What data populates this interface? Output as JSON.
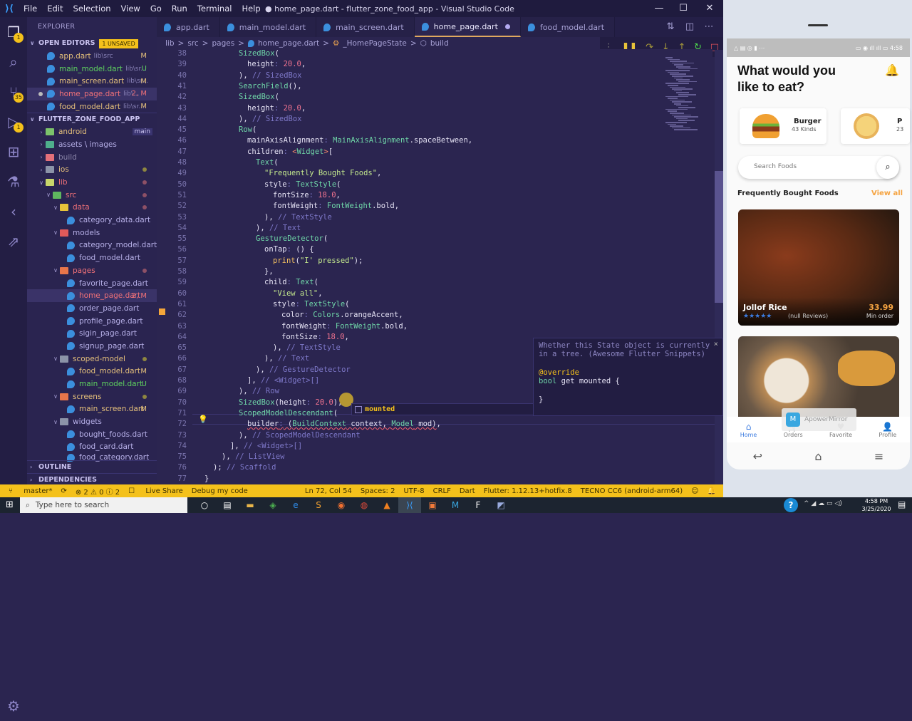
{
  "titlebar": {
    "menus": [
      "File",
      "Edit",
      "Selection",
      "View",
      "Go",
      "Run",
      "Terminal",
      "Help"
    ],
    "title": "● home_page.dart - flutter_zone_food_app - Visual Studio Code",
    "minimize": "—",
    "maximize": "☐",
    "close": "✕"
  },
  "activity": {
    "explorer_badge": "1",
    "scm_badge": "35",
    "debug_badge": "1"
  },
  "sidebar": {
    "header": "EXPLORER",
    "open_editors_label": "OPEN EDITORS",
    "unsaved_badge": "1 UNSAVED",
    "open_editors": [
      {
        "name": "app.dart",
        "path": "lib\\src",
        "status": "M"
      },
      {
        "name": "main_model.dart",
        "path": "lib\\sr...",
        "status": "U"
      },
      {
        "name": "main_screen.dart",
        "path": "lib\\sr...",
        "status": "M"
      },
      {
        "name": "home_page.dart",
        "path": "lib\\...",
        "status": "2, M"
      },
      {
        "name": "food_model.dart",
        "path": "lib\\sr...",
        "status": "M"
      }
    ],
    "project_label": "FLUTTER_ZONE_FOOD_APP",
    "branch_tooltip": "main",
    "tree": [
      {
        "name": "android"
      },
      {
        "name": "assets \\ images"
      },
      {
        "name": "build"
      },
      {
        "name": "ios"
      },
      {
        "name": "lib"
      },
      {
        "name": "src"
      },
      {
        "name": "data"
      },
      {
        "name": "category_data.dart"
      },
      {
        "name": "models"
      },
      {
        "name": "category_model.dart"
      },
      {
        "name": "food_model.dart"
      },
      {
        "name": "pages"
      },
      {
        "name": "favorite_page.dart"
      },
      {
        "name": "home_page.dart",
        "status": "2, M"
      },
      {
        "name": "order_page.dart"
      },
      {
        "name": "profile_page.dart"
      },
      {
        "name": "sigin_page.dart"
      },
      {
        "name": "signup_page.dart"
      },
      {
        "name": "scoped-model"
      },
      {
        "name": "food_model.dart",
        "status": "M"
      },
      {
        "name": "main_model.dart",
        "status": "U"
      },
      {
        "name": "screens"
      },
      {
        "name": "main_screen.dart",
        "status": "M"
      },
      {
        "name": "widgets"
      },
      {
        "name": "bought_foods.dart"
      },
      {
        "name": "food_card.dart"
      },
      {
        "name": "food_category.dart"
      }
    ],
    "outline_label": "OUTLINE",
    "dependencies_label": "DEPENDENCIES"
  },
  "tabs": [
    {
      "label": "app.dart"
    },
    {
      "label": "main_model.dart"
    },
    {
      "label": "main_screen.dart"
    },
    {
      "label": "home_page.dart"
    },
    {
      "label": "food_model.dart"
    }
  ],
  "breadcrumb": [
    "lib",
    ">",
    "src",
    ">",
    "pages",
    ">",
    "home_page.dart",
    ">",
    "_HomePageState",
    ">",
    "build"
  ],
  "editor": {
    "line_numbers": [
      "38",
      "39",
      "40",
      "41",
      "42",
      "43",
      "44",
      "45",
      "46",
      "47",
      "48",
      "49",
      "50",
      "51",
      "52",
      "53",
      "54",
      "55",
      "56",
      "57",
      "58",
      "59",
      "60",
      "61",
      "62",
      "63",
      "64",
      "65",
      "66",
      "67",
      "68",
      "69",
      "70",
      "71",
      "72",
      "73",
      "74",
      "75",
      "76",
      "77"
    ]
  },
  "suggest": {
    "item": "mounted",
    "detail": "Whether this Sta..."
  },
  "docpopup": {
    "desc1": "Whether this State object is currently",
    "desc2": "in a tree. (Awesome Flutter Snippets)",
    "l1": "@override",
    "l2a": "bool",
    "l2b": " get mounted {",
    "l3": "}",
    "close": "×"
  },
  "status": {
    "branch": "master*",
    "sync": "⟳",
    "problems": "⊗ 2 ⚠ 0 ⓘ 2",
    "liveshare": "Live Share",
    "debug": "Debug my code",
    "position": "Ln 72, Col 54",
    "spaces": "Spaces: 2",
    "encoding": "UTF-8",
    "eol": "CRLF",
    "language": "Dart",
    "flutter": "Flutter: 1.12.13+hotfix.8",
    "device": "TECNO CC6 (android-arm64)"
  },
  "taskbar": {
    "search_placeholder": "Type here to search",
    "time": "4:58 PM",
    "date": "3/25/2020"
  },
  "phone": {
    "status_time": "4:58",
    "heading": "What would you like to eat?",
    "categories": [
      {
        "name": "Burger",
        "count": "43 Kinds"
      },
      {
        "name": "P",
        "count": "23"
      }
    ],
    "search_placeholder": "Search Foods",
    "section_title": "Frequently Bought Foods",
    "view_all": "View all",
    "food": {
      "name": "Jollof Rice",
      "rating": 5,
      "reviews": "(null Reviews)",
      "price": "33.99",
      "price_label": "Min order"
    },
    "overlay": "ApowerMirror",
    "nav": [
      {
        "label": "Home"
      },
      {
        "label": "Orders"
      },
      {
        "label": "Favorite"
      },
      {
        "label": "Profile"
      }
    ],
    "accent": "#f5a442",
    "nav_active": "#3b7be0"
  }
}
